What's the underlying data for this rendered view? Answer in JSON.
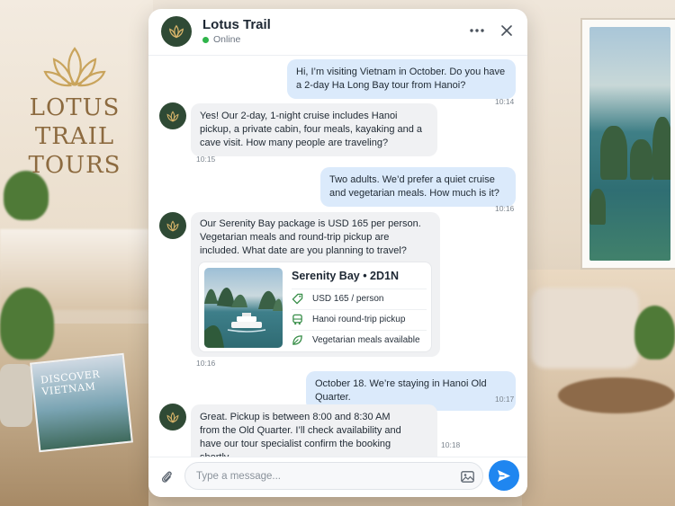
{
  "background": {
    "logo_line1": "LOTUS TRAIL",
    "logo_line2": "TOURS",
    "book_line1": "DISCOVER",
    "book_line2": "VIETNAM"
  },
  "header": {
    "title": "Lotus Trail",
    "status": "Online",
    "more_icon": "more-horizontal-icon",
    "close_icon": "close-icon"
  },
  "messages": [
    {
      "from": "user",
      "text": "Hi, I’m visiting Vietnam in October. Do you have a 2-day Ha Long Bay tour from Hanoi?",
      "time": "10:14"
    },
    {
      "from": "agent",
      "text": "Yes! Our 2-day, 1-night cruise includes Hanoi pickup, a private cabin, four meals, kayaking and a cave visit. How many people are traveling?",
      "time": "10:15"
    },
    {
      "from": "user",
      "text": "Two adults. We’d prefer a quiet cruise and vegetarian meals. How much is it?",
      "time": "10:16"
    },
    {
      "from": "agent",
      "text": "Our Serenity Bay package is USD 165 per person. Vegetarian meals and round-trip pickup are included. What date are you planning to travel?",
      "time": "10:16"
    },
    {
      "from": "user",
      "text": "October 18. We’re staying in Hanoi Old Quarter.",
      "time": "10:17"
    },
    {
      "from": "agent",
      "text": "Great. Pickup is between 8:00 and 8:30 AM from the Old Quarter. I’ll check availability and have our tour specialist confirm the booking shortly.",
      "time": "10:18"
    }
  ],
  "card": {
    "title": "Serenity Bay • 2D1N",
    "rows": [
      {
        "icon": "price-tag-icon",
        "text": "USD 165 / person"
      },
      {
        "icon": "bus-icon",
        "text": "Hanoi round-trip pickup"
      },
      {
        "icon": "leaf-icon",
        "text": "Vegetarian meals available"
      }
    ]
  },
  "composer": {
    "placeholder": "Type a message...",
    "attach_icon": "paperclip-icon",
    "image_icon": "image-icon",
    "send_icon": "send-icon"
  },
  "colors": {
    "brand_dark_green": "#2f4a35",
    "logo_gold": "#c9a45c",
    "online_green": "#2fb44a",
    "outgoing_bubble": "#dbeafb",
    "incoming_bubble": "#f0f1f3",
    "send_button": "#1f86f0"
  }
}
